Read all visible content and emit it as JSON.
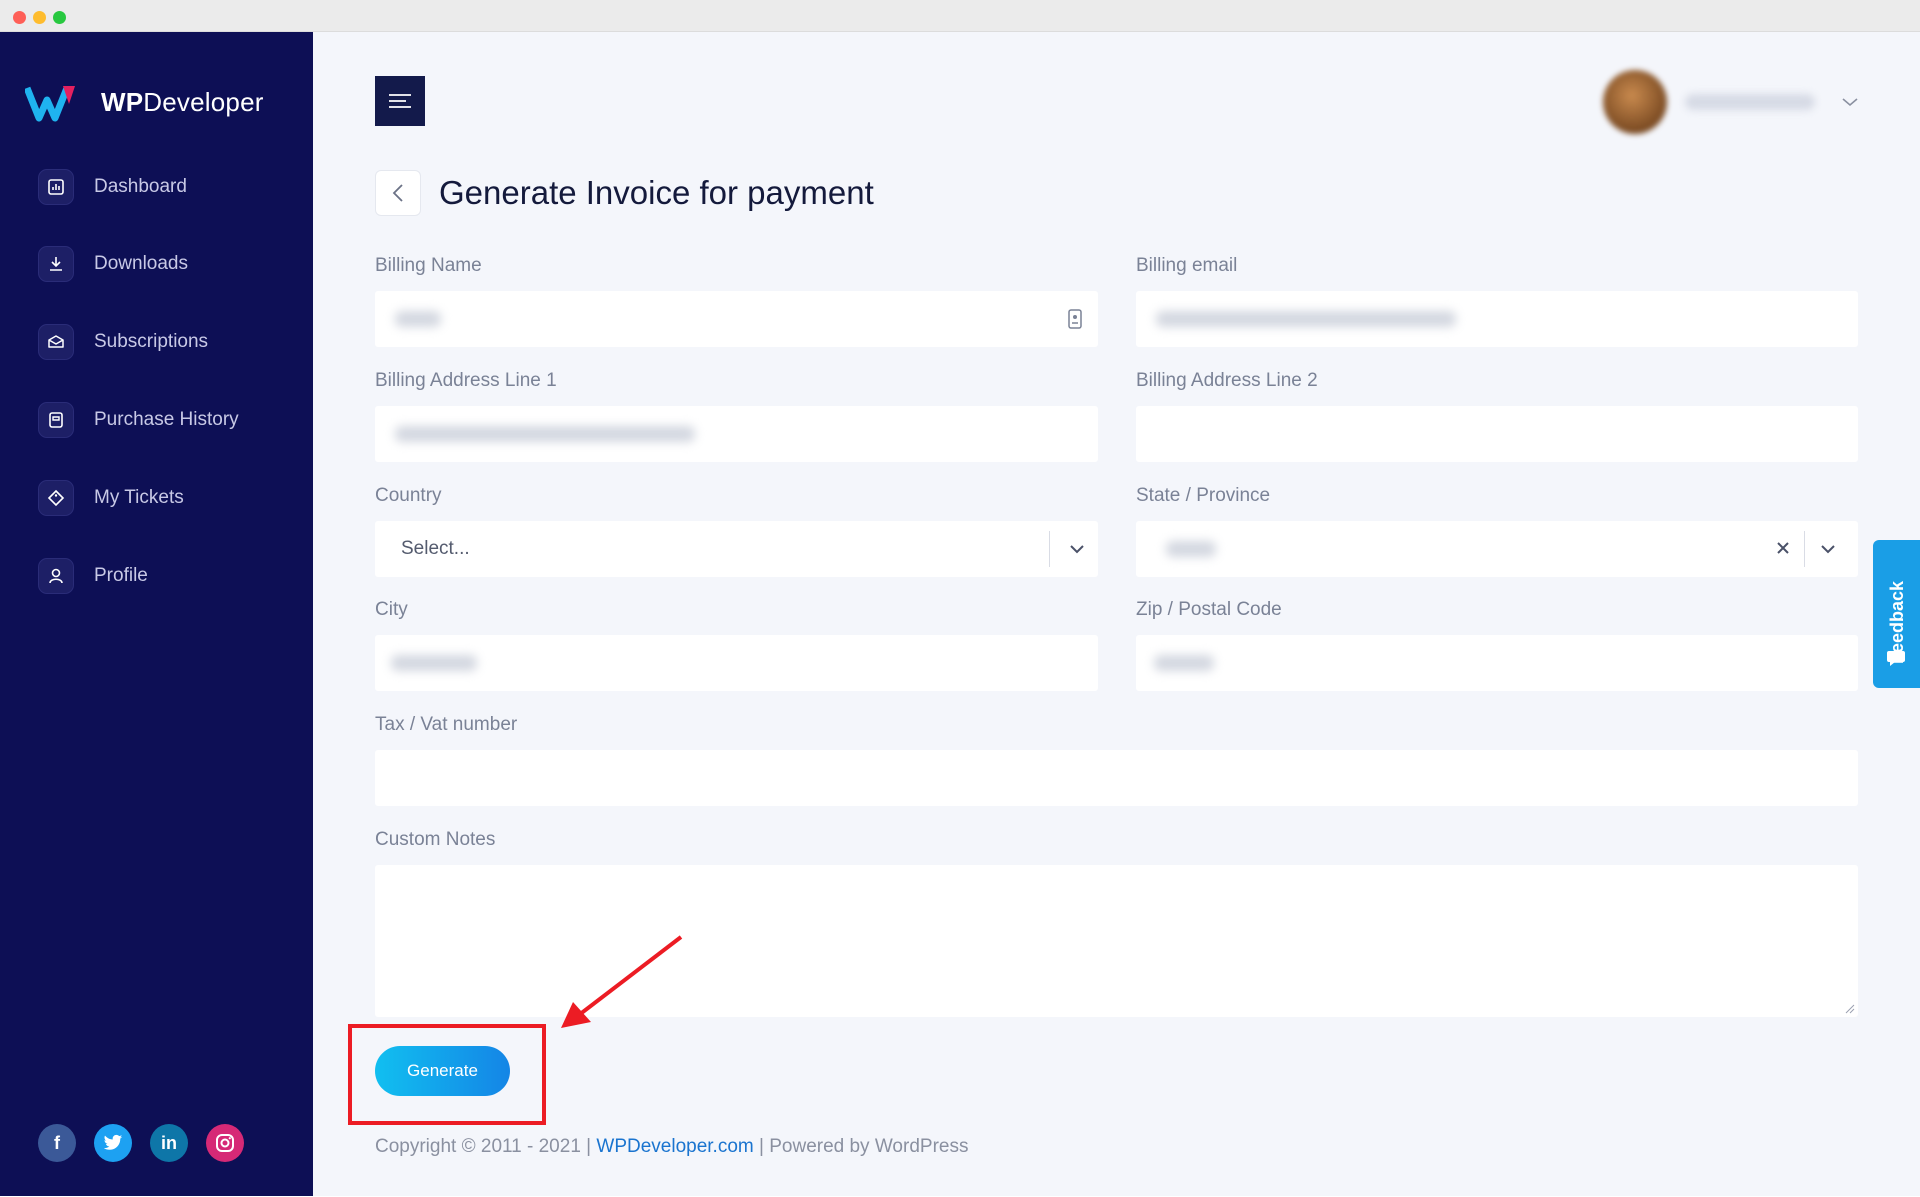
{
  "brand": {
    "name_bold": "WP",
    "name_rest": "Developer"
  },
  "sidebar": {
    "items": [
      {
        "label": "Dashboard",
        "icon": "chart-icon"
      },
      {
        "label": "Downloads",
        "icon": "download-icon"
      },
      {
        "label": "Subscriptions",
        "icon": "box-icon"
      },
      {
        "label": "Purchase History",
        "icon": "receipt-icon"
      },
      {
        "label": "My Tickets",
        "icon": "ticket-icon"
      },
      {
        "label": "Profile",
        "icon": "user-icon"
      }
    ],
    "social": [
      {
        "icon": "facebook-icon",
        "glyph": "f",
        "color": "#3b5998"
      },
      {
        "icon": "twitter-icon",
        "glyph": "t",
        "color": "#1da1f2"
      },
      {
        "icon": "linkedin-icon",
        "glyph": "in",
        "color": "#0e76a8"
      },
      {
        "icon": "instagram-icon",
        "glyph": "◎",
        "color": "#d62976"
      }
    ]
  },
  "page": {
    "title": "Generate Invoice for payment"
  },
  "form": {
    "billing_name_label": "Billing Name",
    "billing_email_label": "Billing email",
    "address1_label": "Billing Address Line 1",
    "address2_label": "Billing Address Line 2",
    "country_label": "Country",
    "country_placeholder": "Select...",
    "state_label": "State / Province",
    "city_label": "City",
    "zip_label": "Zip / Postal Code",
    "tax_label": "Tax / Vat number",
    "notes_label": "Custom Notes",
    "generate_label": "Generate"
  },
  "footer": {
    "prefix": "Copyright © 2011 - 2021 | ",
    "link": "WPDeveloper.com",
    "suffix": " | Powered by WordPress"
  },
  "feedback": {
    "label": "Feedback"
  },
  "colors": {
    "sidebar": "#0d0f55",
    "accent": "#1485e6",
    "highlight": "#ec1c24"
  }
}
